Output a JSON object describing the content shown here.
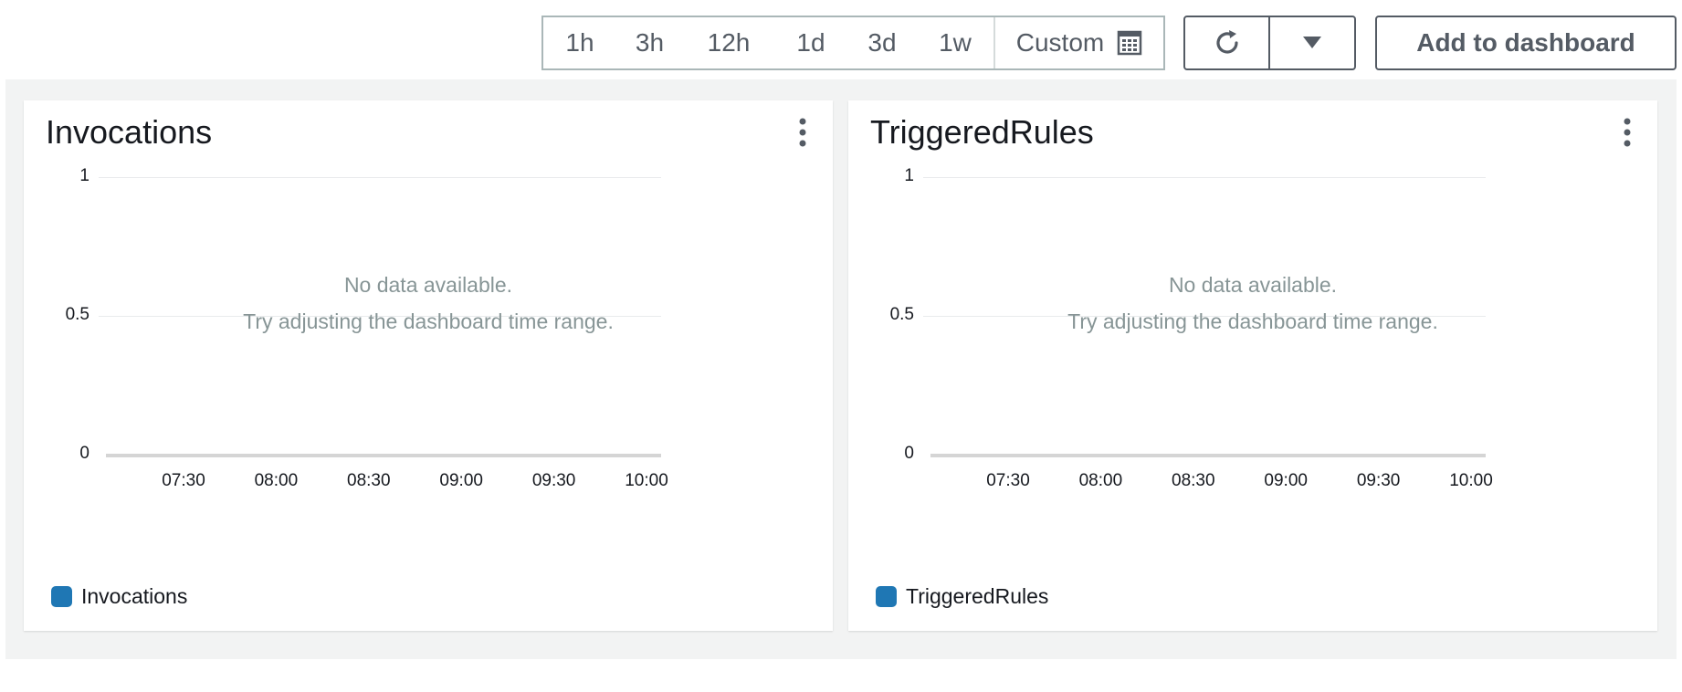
{
  "toolbar": {
    "time_ranges": [
      "1h",
      "3h",
      "12h",
      "1d",
      "3d",
      "1w"
    ],
    "custom_label": "Custom",
    "add_to_dashboard_label": "Add to dashboard"
  },
  "icons": {
    "calendar": "calendar-icon",
    "refresh": "refresh-icon",
    "dropdown": "caret-down-icon",
    "menu": "vertical-ellipsis-icon"
  },
  "colors": {
    "series": "#1f77b4",
    "nodata_text": "#879596",
    "canvas_bg": "#f2f3f3"
  },
  "widgets": [
    {
      "title": "Invocations",
      "nodata_line1": "No data available.",
      "nodata_line2": "Try adjusting the dashboard time range.",
      "legend": "Invocations"
    },
    {
      "title": "TriggeredRules",
      "nodata_line1": "No data available.",
      "nodata_line2": "Try adjusting the dashboard time range.",
      "legend": "TriggeredRules"
    }
  ],
  "chart_data": [
    {
      "type": "line",
      "title": "Invocations",
      "x_ticks": [
        "07:30",
        "08:00",
        "08:30",
        "09:00",
        "09:30",
        "10:00"
      ],
      "y_ticks": [
        "1",
        "0.5",
        "0"
      ],
      "ylim": [
        0,
        1
      ],
      "series": [
        {
          "name": "Invocations",
          "values": []
        }
      ],
      "grid": true,
      "legend": "bottom-left"
    },
    {
      "type": "line",
      "title": "TriggeredRules",
      "x_ticks": [
        "07:30",
        "08:00",
        "08:30",
        "09:00",
        "09:30",
        "10:00"
      ],
      "y_ticks": [
        "1",
        "0.5",
        "0"
      ],
      "ylim": [
        0,
        1
      ],
      "series": [
        {
          "name": "TriggeredRules",
          "values": []
        }
      ],
      "grid": true,
      "legend": "bottom-left"
    }
  ]
}
